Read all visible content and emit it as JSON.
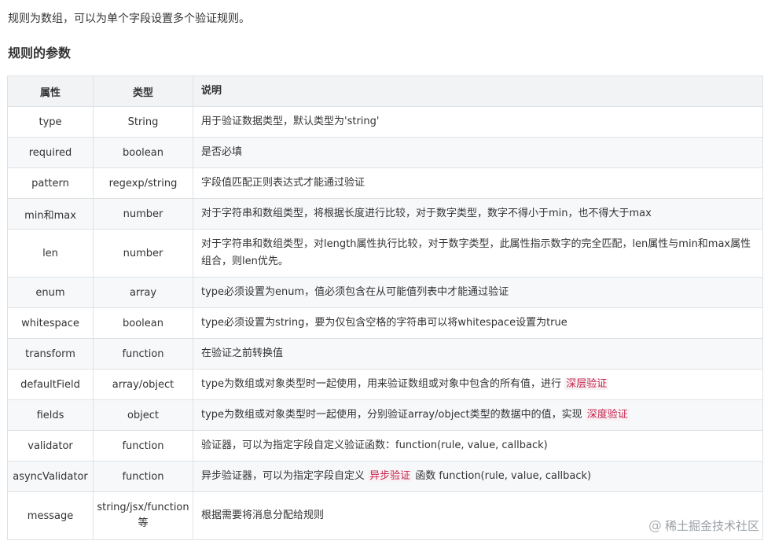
{
  "intro": "规则为数组，可以为单个字段设置多个验证规则。",
  "section_title": "规则的参数",
  "table": {
    "headers": [
      "属性",
      "类型",
      "说明"
    ],
    "rows": [
      {
        "attr": "type",
        "type": "String",
        "desc": "用于验证数据类型，默认类型为'string'"
      },
      {
        "attr": "required",
        "type": "boolean",
        "desc": "是否必填"
      },
      {
        "attr": "pattern",
        "type": "regexp/string",
        "desc": "字段值匹配正则表达式才能通过验证"
      },
      {
        "attr": "min和max",
        "type": "number",
        "desc": "对于字符串和数组类型，将根据长度进行比较，对于数字类型，数字不得小于min，也不得大于max"
      },
      {
        "attr": "len",
        "type": "number",
        "desc": "对于字符串和数组类型，对length属性执行比较，对于数字类型，此属性指示数字的完全匹配，len属性与min和max属性组合，则len优先。"
      },
      {
        "attr": "enum",
        "type": "array",
        "desc": "type必须设置为enum，值必须包含在从可能值列表中才能通过验证"
      },
      {
        "attr": "whitespace",
        "type": "boolean",
        "desc": "type必须设置为string，要为仅包含空格的字符串可以将whitespace设置为true"
      },
      {
        "attr": "transform",
        "type": "function",
        "desc": "在验证之前转换值"
      },
      {
        "attr": "defaultField",
        "type": "array/object",
        "desc": "type为数组或对象类型时一起使用，用来验证数组或对象中包含的所有值，进行 ",
        "link": "深层验证"
      },
      {
        "attr": "fields",
        "type": "object",
        "desc": "type为数组或对象类型时一起使用，分别验证array/object类型的数据中的值，实现 ",
        "link": "深度验证"
      },
      {
        "attr": "validator",
        "type": "function",
        "desc": "验证器，可以为指定字段自定义验证函数：function(rule, value, callback)"
      },
      {
        "attr": "asyncValidator",
        "type": "function",
        "desc": "异步验证器，可以为指定字段自定义 ",
        "link": "异步验证",
        "desc_after": " 函数 function(rule, value, callback)"
      },
      {
        "attr": "message",
        "type": "string/jsx/function等",
        "desc": "根据需要将消息分配给规则"
      }
    ]
  },
  "watermark": {
    "at": "@",
    "text": "稀土掘金技术社区"
  }
}
